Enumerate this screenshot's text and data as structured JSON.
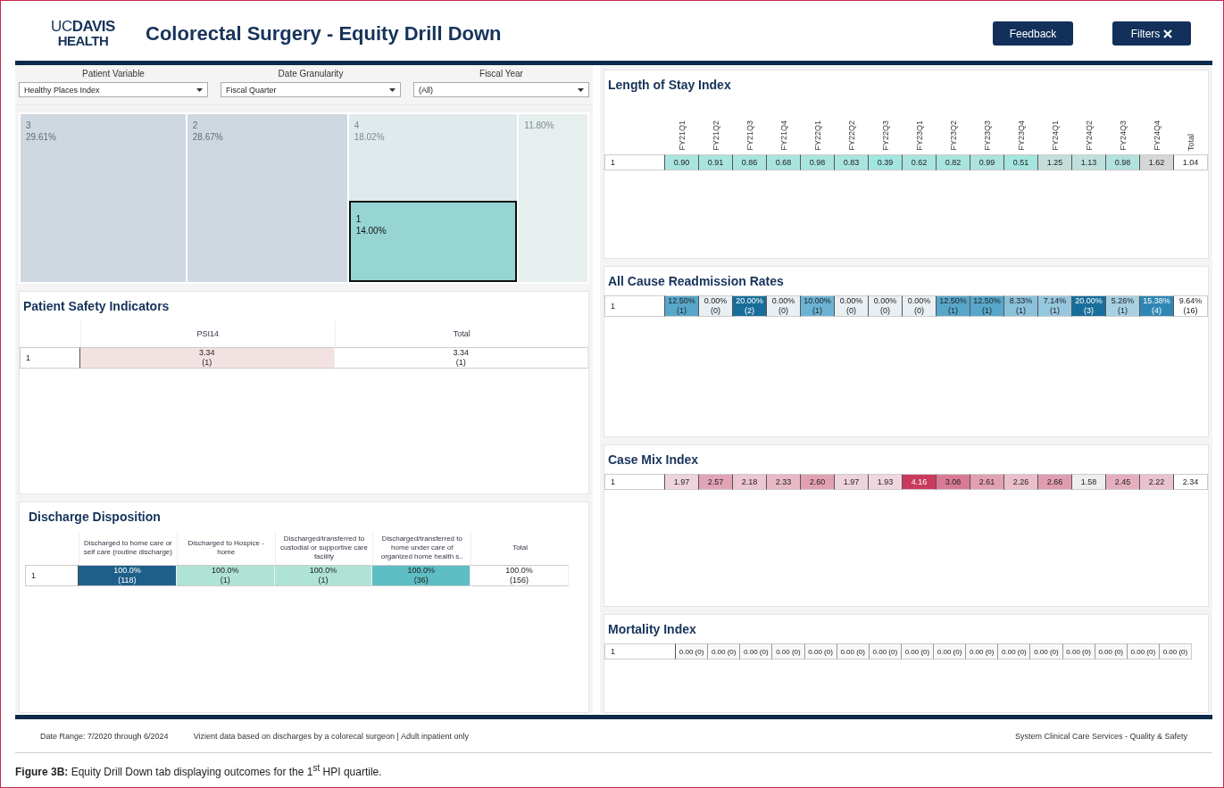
{
  "header": {
    "logo": [
      "UC**DAVIS**",
      "HEALTH"
    ],
    "title": "Colorectal Surgery - Equity Drill Down",
    "buttons": [
      {
        "label": "Feedback",
        "kind": "plain"
      },
      {
        "label": "Filters",
        "kind": "close"
      }
    ]
  },
  "filters": [
    {
      "label": "Patient Variable",
      "value": "Healthy Places Index"
    },
    {
      "label": "Date Granularity",
      "value": "Fiscal Quarter"
    },
    {
      "label": "Fiscal Year",
      "value": "(All)"
    }
  ],
  "treemap": {
    "tiles": [
      {
        "label": "3",
        "value": "29.61%",
        "color": "#cfd8e0",
        "selected": false
      },
      {
        "label": "2",
        "value": "28.67%",
        "color": "#cfd8e0",
        "selected": false
      },
      {
        "label": "4",
        "value": "18.02%",
        "color": "#dfeaec",
        "selected": false
      },
      {
        "label": "1",
        "value": "14.00%",
        "color": "#97d5d4",
        "selected": true
      },
      {
        "value": "11.80%",
        "color": "#e6eeee",
        "selected": false
      }
    ]
  },
  "left_panels": [
    {
      "title": "Patient Safety Indicators",
      "kind": "plain",
      "columns": [
        "PSI14",
        "Total"
      ],
      "rows": [
        {
          "label": "1",
          "cells": [
            {
              "text": "3.34\n(1)",
              "color": "#f2e2e2"
            },
            {
              "text": "3.34\n(1)",
              "color": "#ffffff"
            }
          ]
        }
      ]
    },
    {
      "title": "Discharge Disposition",
      "kind": "plain",
      "columns": [
        "Discharged to home care or self care (routine discharge)",
        "Discharged to Hospice - home",
        "Discharged/transferred to custodial or supportive care facility",
        "Discharged/transferred to home under care of organized home health s..",
        "Total"
      ],
      "rows": [
        {
          "label": "1",
          "cells": [
            {
              "text": "100.0%\n(118)",
              "color": "#1e5f8a"
            },
            {
              "text": "100.0%\n(1)",
              "color": "#aee3d6"
            },
            {
              "text": "100.0%\n(1)",
              "color": "#aee3d6"
            },
            {
              "text": "100.0%\n(36)",
              "color": "#5fbdc4"
            },
            {
              "text": "100.0%\n(156)",
              "color": "#ffffff"
            }
          ]
        }
      ]
    }
  ],
  "right_panels": [
    {
      "title": "Length of Stay Index",
      "kind": "rotated",
      "columns": [
        "FY21Q1",
        "FY21Q2",
        "FY21Q3",
        "FY21Q4",
        "FY22Q1",
        "FY22Q2",
        "FY22Q3",
        "FY23Q1",
        "FY23Q2",
        "FY23Q3",
        "FY23Q4",
        "FY24Q1",
        "FY24Q2",
        "FY24Q3",
        "FY24Q4",
        "Total"
      ],
      "rows": [
        {
          "label": "1",
          "cells": [
            {
              "text": "0.90",
              "color": "#a9e4df"
            },
            {
              "text": "0.91",
              "color": "#a9e4df"
            },
            {
              "text": "0.86",
              "color": "#a9e4df"
            },
            {
              "text": "0.68",
              "color": "#a9e4df"
            },
            {
              "text": "0.98",
              "color": "#a9e4df"
            },
            {
              "text": "0.83",
              "color": "#a9e4df"
            },
            {
              "text": "0.39",
              "color": "#a2e6e0"
            },
            {
              "text": "0.62",
              "color": "#a9e4df"
            },
            {
              "text": "0.82",
              "color": "#a9e4df"
            },
            {
              "text": "0.99",
              "color": "#ade2dd"
            },
            {
              "text": "0.51",
              "color": "#a5e5df"
            },
            {
              "text": "1.25",
              "color": "#c4dedb"
            },
            {
              "text": "1.13",
              "color": "#bfe0dc"
            },
            {
              "text": "0.98",
              "color": "#b2e2dd"
            },
            {
              "text": "1.62",
              "color": "#d6d6d6"
            },
            {
              "text": "1.04",
              "color": "#ffffff"
            }
          ]
        }
      ]
    },
    {
      "title": "All Cause Readmission Rates",
      "kind": "none",
      "rows": [
        {
          "label": "1",
          "cells": [
            {
              "text": "12.50%\n(1)",
              "color": "#58a7cb"
            },
            {
              "text": "0.00%\n(0)",
              "color": "#e9eff3"
            },
            {
              "text": "20.00%\n(2)",
              "color": "#186e9a"
            },
            {
              "text": "0.00%\n(0)",
              "color": "#e9eff3"
            },
            {
              "text": "10.00%\n(1)",
              "color": "#6cb3d3"
            },
            {
              "text": "0.00%\n(0)",
              "color": "#e9eff3"
            },
            {
              "text": "0.00%\n(0)",
              "color": "#e9eff3"
            },
            {
              "text": "0.00%\n(0)",
              "color": "#e9eff3"
            },
            {
              "text": "12.50%\n(1)",
              "color": "#58a7cb"
            },
            {
              "text": "12.50%\n(1)",
              "color": "#58a7cb"
            },
            {
              "text": "8.33%\n(1)",
              "color": "#8bc1db"
            },
            {
              "text": "7.14%\n(1)",
              "color": "#95c7de"
            },
            {
              "text": "20.00%\n(3)",
              "color": "#186e9a"
            },
            {
              "text": "5.26%\n(1)",
              "color": "#a7d0e3"
            },
            {
              "text": "15.38%\n(4)",
              "color": "#2e87b3"
            },
            {
              "text": "9.64%\n(16)",
              "color": "#ffffff"
            }
          ]
        }
      ]
    },
    {
      "title": "Case Mix Index",
      "kind": "none",
      "rows": [
        {
          "label": "1",
          "cells": [
            {
              "text": "1.97",
              "color": "#efd3dc"
            },
            {
              "text": "2.57",
              "color": "#e3a3b6"
            },
            {
              "text": "2.18",
              "color": "#ecc6d1"
            },
            {
              "text": "2.33",
              "color": "#e8b8c6"
            },
            {
              "text": "2.60",
              "color": "#e2a0b3"
            },
            {
              "text": "1.97",
              "color": "#efd3dc"
            },
            {
              "text": "1.93",
              "color": "#f0d6de"
            },
            {
              "text": "4.16",
              "color": "#c93a5d"
            },
            {
              "text": "3.08",
              "color": "#d97a95"
            },
            {
              "text": "2.61",
              "color": "#e2a0b3"
            },
            {
              "text": "2.26",
              "color": "#eabfcb"
            },
            {
              "text": "2.66",
              "color": "#e09cb0"
            },
            {
              "text": "1.58",
              "color": "#eeeeee"
            },
            {
              "text": "2.45",
              "color": "#e5aebe"
            },
            {
              "text": "2.22",
              "color": "#eac2ce"
            },
            {
              "text": "2.34",
              "color": "#ffffff"
            }
          ]
        }
      ]
    },
    {
      "title": "Mortality Index",
      "kind": "none",
      "rows": [
        {
          "label": "1",
          "cells": [
            {
              "text": "0.00 (0)"
            },
            {
              "text": "0.00 (0)"
            },
            {
              "text": "0.00 (0)"
            },
            {
              "text": "0.00 (0)"
            },
            {
              "text": "0.00 (0)"
            },
            {
              "text": "0.00 (0)"
            },
            {
              "text": "0.00 (0)"
            },
            {
              "text": "0.00 (0)"
            },
            {
              "text": "0.00 (0)"
            },
            {
              "text": "0.00 (0)"
            },
            {
              "text": "0.00 (0)"
            },
            {
              "text": "0.00 (0)"
            },
            {
              "text": "0.00 (0)"
            },
            {
              "text": "0.00 (0)"
            },
            {
              "text": "0.00 (0)"
            },
            {
              "text": "0.00 (0)"
            }
          ]
        }
      ]
    }
  ],
  "footer": [
    "Date Range: 7/2020 through 6/2024",
    "Vizient data based on discharges by a colorecal surgeon | Adult inpatient only",
    "System Clinical Care Services - Quality & Safety"
  ],
  "caption": "**Figure 3B:** Equity Drill Down tab displaying outcomes for the 1$^{st}$ HPI quartile."
}
